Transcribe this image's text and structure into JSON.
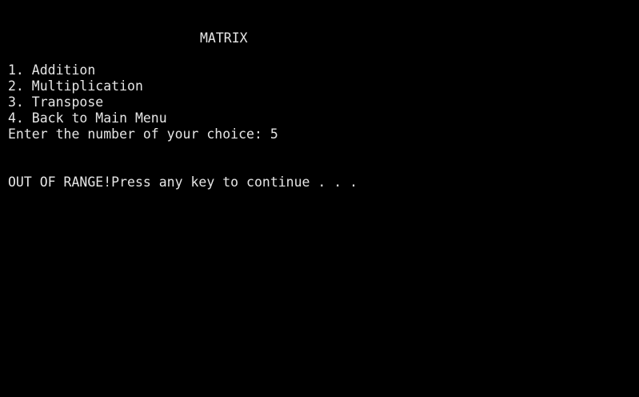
{
  "console": {
    "title": "MATRIX",
    "menu": [
      "1. Addition",
      "2. Multiplication",
      "3. Transpose",
      "4. Back to Main Menu"
    ],
    "prompt_label": "Enter the number of your choice: ",
    "prompt_input": "5",
    "error_text": "OUT OF RANGE!",
    "continue_text": "Press any key to continue . . .",
    "colors": {
      "background": "#000000",
      "text": "#e6e6e6"
    }
  }
}
